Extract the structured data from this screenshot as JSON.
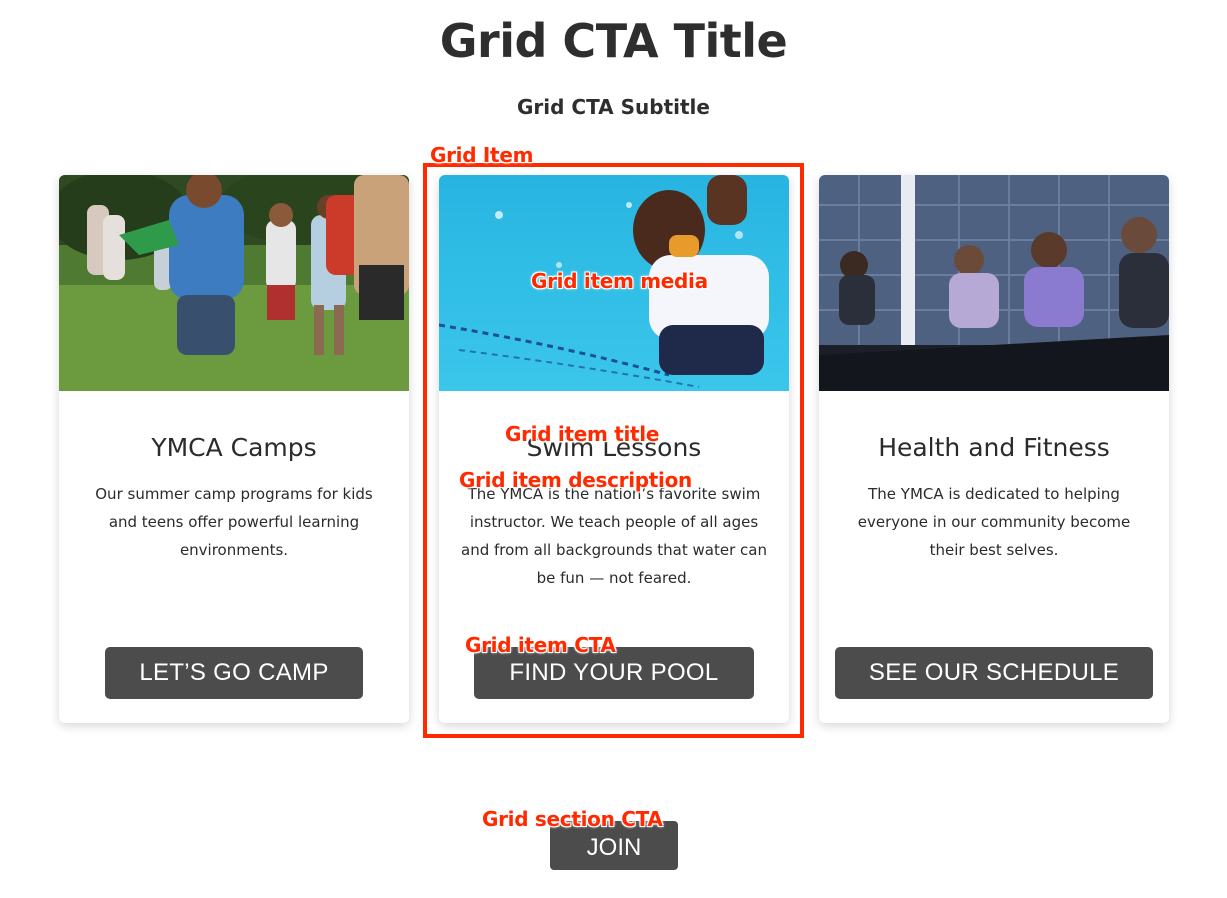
{
  "header": {
    "title": "Grid CTA Title",
    "subtitle": "Grid CTA Subtitle"
  },
  "cards": [
    {
      "title": "YMCA Camps",
      "description": "Our summer camp programs for kids and teens offer powerful learning environments.",
      "cta": "LET’S GO CAMP",
      "media_icon": "camp-photo"
    },
    {
      "title": "Swim Lessons",
      "description": "The YMCA is the nation’s favorite swim instructor. We teach people of all ages and from all backgrounds that water can be fun — not feared.",
      "cta": "FIND YOUR POOL",
      "media_icon": "swim-photo"
    },
    {
      "title": "Health and Fitness",
      "description": "The YMCA is dedicated to helping everyone in our community become their best selves.",
      "cta": "SEE OUR SCHEDULE",
      "media_icon": "fitness-photo"
    }
  ],
  "section_cta": "JOIN",
  "annotations": {
    "grid_item": "Grid Item",
    "grid_item_media": "Grid item media",
    "grid_item_title": "Grid item title",
    "grid_item_description": "Grid item description",
    "grid_item_cta": "Grid item CTA",
    "grid_section_cta": "Grid section CTA"
  },
  "colors": {
    "annotation": "#ff2a00",
    "button": "#4c4c4c",
    "text": "#2b2b2b"
  }
}
